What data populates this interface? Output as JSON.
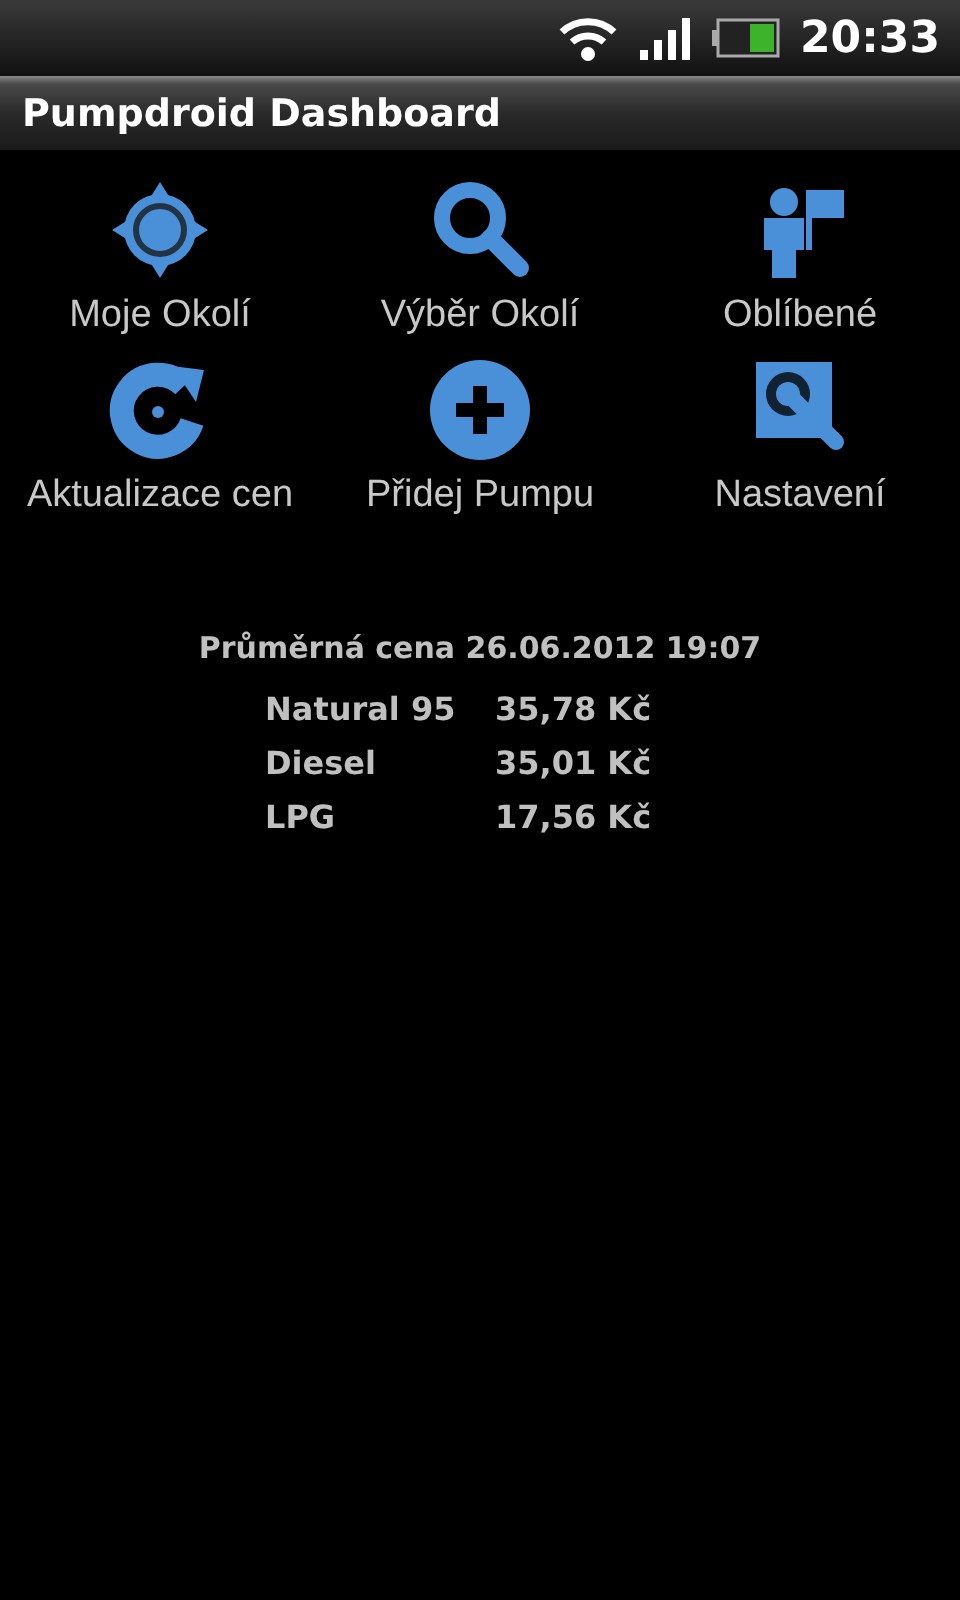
{
  "status_bar": {
    "time": "20:33"
  },
  "title_bar": {
    "title": "Pumpdroid Dashboard"
  },
  "dashboard": [
    {
      "kind": "location",
      "label": "Moje Okolí"
    },
    {
      "kind": "search",
      "label": "Výběr Okolí"
    },
    {
      "kind": "favorites",
      "label": "Oblíbené"
    },
    {
      "kind": "refresh",
      "label": "Aktualizace cen"
    },
    {
      "kind": "add",
      "label": "Přidej Pumpu"
    },
    {
      "kind": "settings",
      "label": "Nastavení"
    }
  ],
  "average": {
    "heading": "Průměrná cena 26.06.2012 19:07",
    "rows": [
      {
        "fuel": "Natural 95",
        "price": "35,78 Kč"
      },
      {
        "fuel": "Diesel",
        "price": "35,01 Kč"
      },
      {
        "fuel": "LPG",
        "price": "17,56 Kč"
      }
    ]
  }
}
